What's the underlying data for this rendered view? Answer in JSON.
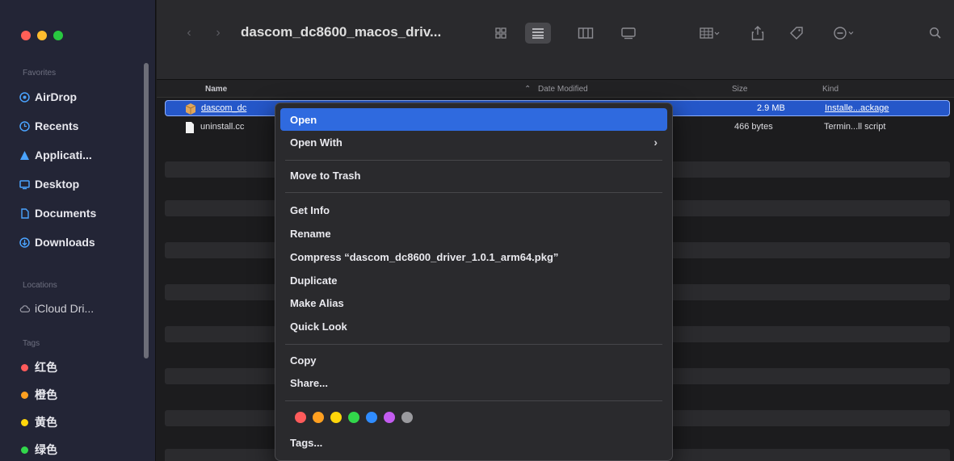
{
  "window": {
    "title": "dascom_dc8600_macos_driv..."
  },
  "sidebar": {
    "favorites_label": "Favorites",
    "favorites": [
      {
        "label": "AirDrop",
        "icon": "airdrop-icon",
        "color": "#4aa3ff"
      },
      {
        "label": "Recents",
        "icon": "clock-icon",
        "color": "#4aa3ff"
      },
      {
        "label": "Applicati...",
        "icon": "applications-icon",
        "color": "#4aa3ff"
      },
      {
        "label": "Desktop",
        "icon": "desktop-icon",
        "color": "#4aa3ff"
      },
      {
        "label": "Documents",
        "icon": "document-icon",
        "color": "#4aa3ff"
      },
      {
        "label": "Downloads",
        "icon": "download-icon",
        "color": "#4aa3ff"
      }
    ],
    "locations_label": "Locations",
    "locations": [
      {
        "label": "iCloud Dri...",
        "icon": "cloud-icon"
      }
    ],
    "tags_label": "Tags",
    "tags": [
      {
        "label": "红色",
        "color": "#ff5b5b"
      },
      {
        "label": "橙色",
        "color": "#ffa020"
      },
      {
        "label": "黄色",
        "color": "#ffd60a"
      },
      {
        "label": "绿色",
        "color": "#32d74b"
      }
    ]
  },
  "columns": {
    "name": "Name",
    "date": "Date Modified",
    "size": "Size",
    "kind": "Kind"
  },
  "files": [
    {
      "name": "dascom_dc",
      "size": "2.9 MB",
      "kind": "Installe...ackage",
      "selected": true
    },
    {
      "name": "uninstall.cc",
      "size": "466 bytes",
      "kind": "Termin...ll script",
      "selected": false
    }
  ],
  "context_menu": {
    "open": "Open",
    "open_with": "Open With",
    "move_to_trash": "Move to Trash",
    "get_info": "Get Info",
    "rename": "Rename",
    "compress": "Compress “dascom_dc8600_driver_1.0.1_arm64.pkg”",
    "duplicate": "Duplicate",
    "make_alias": "Make Alias",
    "quick_look": "Quick Look",
    "copy": "Copy",
    "share": "Share...",
    "tags": "Tags...",
    "tag_colors": [
      "#ff5b5b",
      "#ffa020",
      "#ffd60a",
      "#32d74b",
      "#2f8cff",
      "#c35cf0",
      "#9a9a9e"
    ]
  },
  "accent": "#2f6adf"
}
